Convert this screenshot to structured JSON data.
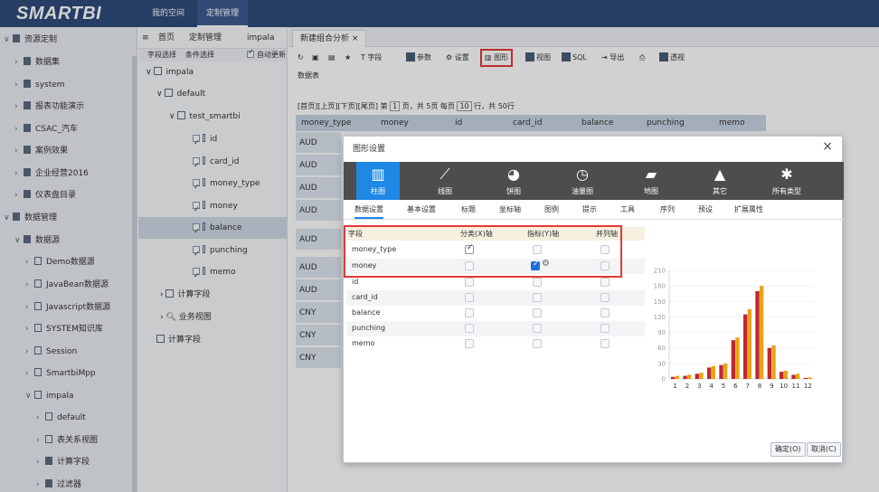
{
  "app": {
    "logo": "SMARTBI",
    "nav": [
      "我的空间",
      "定制管理"
    ]
  },
  "sidebar": {
    "items": [
      {
        "label": "资源定制",
        "arrow": "∨"
      },
      {
        "label": "数据集",
        "arrow": "›"
      },
      {
        "label": "system",
        "arrow": "›"
      },
      {
        "label": "报表功能演示",
        "arrow": "›"
      },
      {
        "label": "CSAC_汽车",
        "arrow": "›"
      },
      {
        "label": "案例效果",
        "arrow": "›"
      },
      {
        "label": "企业经营2016",
        "arrow": "›"
      },
      {
        "label": "仪表盘目录",
        "arrow": "›"
      },
      {
        "label": "数据管理",
        "arrow": "∨"
      },
      {
        "label": "数据源",
        "arrow": "∨"
      },
      {
        "label": "Demo数据源",
        "arrow": "›"
      },
      {
        "label": "JavaBean数据源",
        "arrow": "›"
      },
      {
        "label": "Javascript数据源",
        "arrow": "›"
      },
      {
        "label": "SYSTEM知识库",
        "arrow": "›"
      },
      {
        "label": "Session",
        "arrow": "›"
      },
      {
        "label": "SmartbiMpp",
        "arrow": "›"
      },
      {
        "label": "impala",
        "arrow": "∨"
      },
      {
        "label": "default",
        "arrow": "›"
      },
      {
        "label": "表关系视图",
        "arrow": "›"
      },
      {
        "label": "计算字段",
        "arrow": "›"
      },
      {
        "label": "过滤器",
        "arrow": "›"
      }
    ]
  },
  "midpanel": {
    "breadcrumb": [
      "首页",
      "定制管理",
      "impala"
    ],
    "tabs": [
      "字段选择",
      "条件选择"
    ],
    "auto_refresh": "自动更新",
    "tree": {
      "impala": "impala",
      "default": "default",
      "table": "test_smartbi",
      "columns": [
        "id",
        "card_id",
        "money_type",
        "money",
        "balance",
        "punching",
        "memo"
      ],
      "calc_fields": "计算字段",
      "biz_view": "业务视图",
      "calc_fields2": "计算字段"
    }
  },
  "content": {
    "tab_label": "新建组合分析",
    "toolbar": {
      "field": "字段",
      "param": "参数",
      "settings": "设置",
      "chart": "图形",
      "view": "视图",
      "sql": "SQL",
      "export": "导出",
      "print": "",
      "pivot": "透视"
    },
    "subtitle": "数据表",
    "pager": {
      "text1": "[首页][上页][下页][尾页] 第",
      "page": "1",
      "text2": "页，共 5页 每页",
      "rows": "10",
      "text3": "行，共 50行"
    },
    "columns": [
      "money_type",
      "money",
      "id",
      "card_id",
      "balance",
      "punching",
      "memo"
    ],
    "currency_cells": [
      "AUD",
      "AUD",
      "AUD",
      "AUD",
      "AUD",
      "AUD",
      "AUD",
      "CNY",
      "CNY",
      "CNY"
    ]
  },
  "dialog": {
    "title": "图形设置",
    "chart_types": [
      {
        "label": "柱图",
        "icon": "bar-chart-icon",
        "glyph": "▥"
      },
      {
        "label": "线图",
        "icon": "line-chart-icon",
        "glyph": "⟋"
      },
      {
        "label": "饼图",
        "icon": "pie-chart-icon",
        "glyph": "◕"
      },
      {
        "label": "油量图",
        "icon": "gauge-icon",
        "glyph": "◷"
      },
      {
        "label": "地图",
        "icon": "map-icon",
        "glyph": "▰"
      },
      {
        "label": "其它",
        "icon": "mountain-icon",
        "glyph": "▲"
      },
      {
        "label": "所有类型",
        "icon": "all-types-icon",
        "glyph": "✱"
      }
    ],
    "setting_tabs": [
      "数据设置",
      "基本设置",
      "标题",
      "坐标轴",
      "图例",
      "提示",
      "工具",
      "序列",
      "预设",
      "扩展属性"
    ],
    "field_headers": [
      "字段",
      "分类(X)轴",
      "指标(Y)轴",
      "并列轴"
    ],
    "fields": [
      {
        "name": "money_type",
        "x": true,
        "y": false,
        "par": false
      },
      {
        "name": "money",
        "x": false,
        "y": true,
        "par": false
      },
      {
        "name": "id",
        "x": false,
        "y": false,
        "par": false
      },
      {
        "name": "card_id",
        "x": false,
        "y": false,
        "par": false
      },
      {
        "name": "balance",
        "x": false,
        "y": false,
        "par": false
      },
      {
        "name": "punching",
        "x": false,
        "y": false,
        "par": false
      },
      {
        "name": "memo",
        "x": false,
        "y": false,
        "par": false
      }
    ],
    "ok": "确定(O)",
    "cancel": "取消(C)"
  },
  "chart_data": {
    "type": "bar",
    "categories": [
      "1",
      "2",
      "3",
      "4",
      "5",
      "6",
      "7",
      "8",
      "9",
      "10",
      "11",
      "12"
    ],
    "series": [
      {
        "values": [
          4,
          6,
          10,
          22,
          27,
          75,
          125,
          170,
          60,
          14,
          8,
          2
        ]
      },
      {
        "values": [
          6,
          8,
          12,
          25,
          30,
          80,
          135,
          180,
          65,
          16,
          10,
          3
        ]
      }
    ],
    "colors": [
      "#c0282e",
      "#e8a318"
    ],
    "yticks": [
      0,
      30,
      60,
      90,
      120,
      150,
      180,
      210
    ],
    "ylim": [
      0,
      210
    ],
    "title": "",
    "xlabel": "",
    "ylabel": ""
  }
}
